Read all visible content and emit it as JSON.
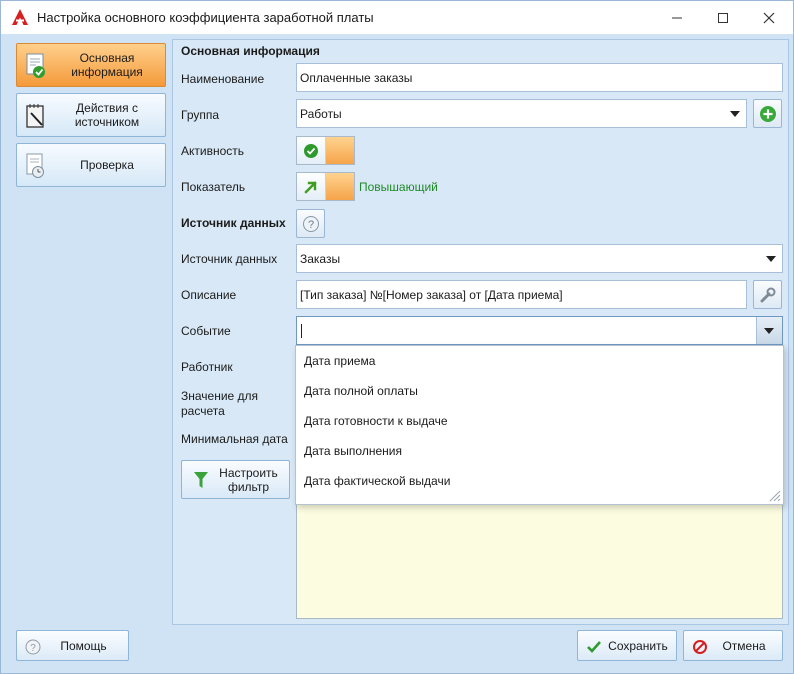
{
  "window": {
    "title": "Настройка основного коэффициента заработной платы",
    "controls": {
      "minimize": "—",
      "maximize": "☐",
      "close": "✕"
    }
  },
  "nav": {
    "items": [
      {
        "label": "Основная информация",
        "icon": "document-check-icon",
        "active": true
      },
      {
        "label": "Действия с источником",
        "icon": "notepad-pen-icon",
        "active": false
      },
      {
        "label": "Проверка",
        "icon": "document-clock-icon",
        "active": false
      }
    ]
  },
  "form": {
    "section_main": "Основная информация",
    "name_label": "Наименование",
    "name_value": "Оплаченные заказы",
    "group_label": "Группа",
    "group_value": "Работы",
    "activity_label": "Активность",
    "indicator_label": "Показатель",
    "indicator_value": "Повышающий",
    "section_source": "Источник данных",
    "source_label": "Источник данных",
    "source_value": "Заказы",
    "description_label": "Описание",
    "description_value": "[Тип заказа] №[Номер  заказа] от [Дата приема]",
    "event_label": "Событие",
    "event_value": "",
    "worker_label": "Работник",
    "calc_value_label": "Значение для расчета",
    "min_date_label": "Минимальная дата",
    "filter_button_label": "Настроить фильтр"
  },
  "event_dropdown": {
    "options": [
      "Дата приема",
      "Дата полной  оплаты",
      "Дата готовности к выдаче",
      "Дата выполнения",
      "Дата фактической выдачи"
    ]
  },
  "footer": {
    "help_label": "Помощь",
    "save_label": "Сохранить",
    "cancel_label": "Отмена"
  },
  "colors": {
    "accent_orange": "#f49a3a",
    "positive_green": "#1f8a27",
    "panel_blue": "#d8e8f6"
  }
}
